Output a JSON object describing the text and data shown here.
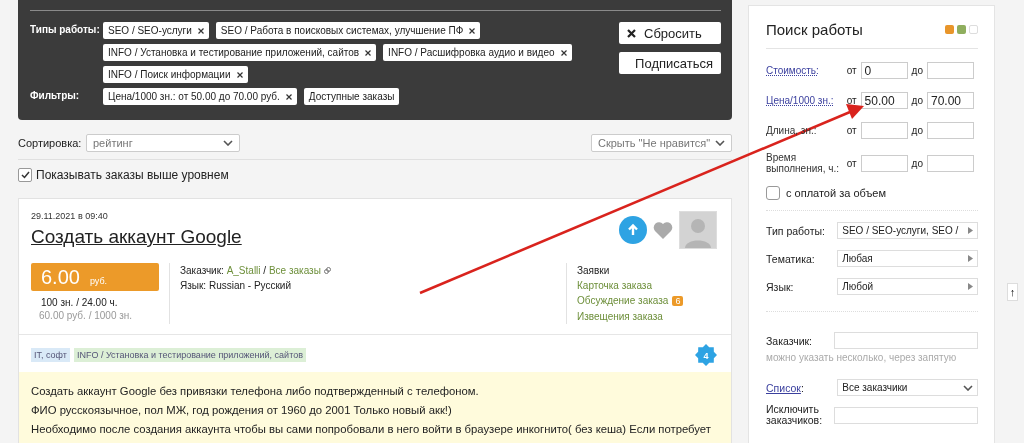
{
  "filter_panel": {
    "rows": [
      {
        "label": "Типы работы:",
        "tags": [
          {
            "text": "SEO / SEO-услуги",
            "removable": true
          },
          {
            "text": "SEO / Работа в поисковых системах, улучшение ПФ",
            "removable": true
          },
          {
            "text": "INFO / Установка и тестирование приложений, сайтов",
            "removable": true
          },
          {
            "text": "INFO / Расшифровка аудио и видео",
            "removable": true
          },
          {
            "text": "INFO / Поиск информации",
            "removable": true
          }
        ]
      },
      {
        "label": "Фильтры:",
        "tags": [
          {
            "text": "Цена/1000 зн.: от 50.00 до 70.00 руб.",
            "removable": true
          },
          {
            "text": "Доступные заказы",
            "removable": false
          }
        ]
      }
    ],
    "buttons": [
      {
        "label": "Сбросить",
        "kind": "reset"
      },
      {
        "label": "Подписаться",
        "kind": "subscribe"
      }
    ]
  },
  "sort": {
    "label": "Сортировка:",
    "value": "рейтинг"
  },
  "hide_select": {
    "value": "Скрыть \"Не нравится\""
  },
  "show_above_level": {
    "label": "Показывать заказы выше уровнем",
    "checked": true
  },
  "order": {
    "date": "29.11.2021 в 09:40",
    "title": "Создать аккаунт Google",
    "price": "6.00",
    "currency": "руб.",
    "volume": "100 зн. / 24.00 ч.",
    "rate": "60.00 руб. / 1000 зн.",
    "customer_label": "Заказчик:",
    "customer": "A_Stalli",
    "separator": "/",
    "all_orders": "Все заказы",
    "language": "Язык: Russian - Русский",
    "links": [
      {
        "label": "Заявки",
        "kind": "header"
      },
      {
        "label": "Карточка заказа",
        "kind": "link"
      },
      {
        "label": "Обсуждение заказа",
        "kind": "link",
        "badge": "6"
      },
      {
        "label": "Извещения заказа",
        "kind": "link"
      }
    ],
    "tags": [
      {
        "text": "IT, софт",
        "color": "#d9e9f7"
      },
      {
        "text": "INFO / Установка и тестирование приложений, сайтов",
        "color": "#dcefd6"
      }
    ],
    "level_badge": "4",
    "description": [
      "Создать аккаунт Google без привязки телефона либо подтвержденный с телефоном.",
      "ФИО русскоязычное, пол МЖ, год рождения от 1960 до 2001 Только новый акк!)",
      "Необходимо после создания аккаунта чтобы вы сами попробовали в него войти в браузере инкогнито( без кеша) Если потребует"
    ]
  },
  "search_panel": {
    "title": "Поиск работы",
    "theme_colors": [
      {
        "color": "#e8952a"
      },
      {
        "color": "#8fae5e"
      },
      {
        "color": "#ffffff"
      }
    ],
    "ranges": [
      {
        "label": "Стоимость:",
        "link": true,
        "from_label": "от",
        "from": "0",
        "to_label": "до"
      },
      {
        "label": "Цена/1000 зн.:",
        "link": true,
        "from_label": "от",
        "from": "50.00",
        "to_label": "до",
        "to": "70.00"
      },
      {
        "label": "Длина, зн.:",
        "link": false,
        "from_label": "от",
        "to_label": "до"
      },
      {
        "label": "Время выполнения, ч.:",
        "link": false,
        "from_label": "от",
        "to_label": "до"
      }
    ],
    "volume_payment": {
      "label": "с оплатой за объем",
      "checked": false
    },
    "selects": [
      {
        "label": "Тип работы:",
        "value": "SEO / SEO-услуги, SEO /"
      },
      {
        "label": "Тематика:",
        "value": "Любая"
      },
      {
        "label": "Язык:",
        "value": "Любой"
      }
    ],
    "customer": {
      "label": "Заказчик:",
      "hint": "можно указать несколько, через запятую"
    },
    "list": {
      "link": "Список",
      "suffix": ":",
      "value": "Все заказчики"
    },
    "exclude": {
      "label": "Исключить заказчиков:"
    }
  },
  "scroll_top": "↑"
}
